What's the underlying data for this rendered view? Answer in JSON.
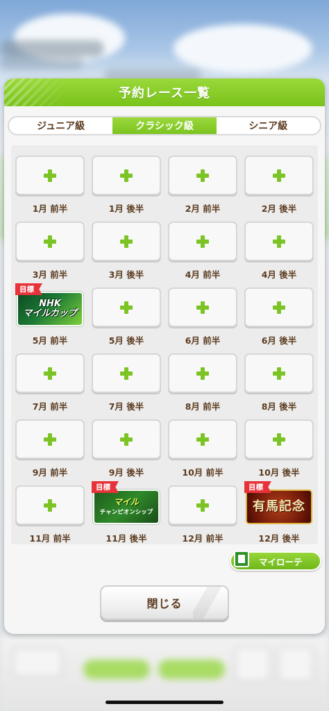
{
  "dialog": {
    "title": "予約レース一覧",
    "tabs": [
      {
        "label": "ジュニア級",
        "active": false
      },
      {
        "label": "クラシック級",
        "active": true
      },
      {
        "label": "シニア級",
        "active": false
      }
    ],
    "slots": [
      {
        "label": "1月 前半"
      },
      {
        "label": "1月 後半"
      },
      {
        "label": "2月 前半"
      },
      {
        "label": "2月 後半"
      },
      {
        "label": "3月 前半"
      },
      {
        "label": "3月 後半"
      },
      {
        "label": "4月 前半"
      },
      {
        "label": "4月 後半"
      },
      {
        "label": "5月 前半",
        "race": {
          "name": "NHKマイルカップ",
          "line1": "NHK",
          "line2": "マイルカップ",
          "tag": "目標"
        }
      },
      {
        "label": "5月 後半"
      },
      {
        "label": "6月 前半"
      },
      {
        "label": "6月 後半"
      },
      {
        "label": "7月 前半"
      },
      {
        "label": "7月 後半"
      },
      {
        "label": "8月 前半"
      },
      {
        "label": "8月 後半"
      },
      {
        "label": "9月 前半"
      },
      {
        "label": "9月 後半"
      },
      {
        "label": "10月 前半"
      },
      {
        "label": "10月 後半"
      },
      {
        "label": "11月 前半"
      },
      {
        "label": "11月 後半",
        "race": {
          "name": "マイルチャンピオンシップ",
          "line1": "マイル",
          "line2": "チャンピオンシップ",
          "tag": "目標"
        }
      },
      {
        "label": "12月 前半"
      },
      {
        "label": "12月 後半",
        "race": {
          "name": "有馬記念",
          "line1": "有馬記念",
          "line2": "",
          "tag": "目標"
        }
      }
    ],
    "my_rotation_label": "マイローテ",
    "close_label": "閉じる"
  },
  "colors": {
    "accent_green": "#7cc425",
    "label_brown": "#5b3b1f",
    "goal_red": "#e8323a"
  },
  "icons": {
    "empty_slot": "plus-icon",
    "my_rotation": "notebook-icon"
  }
}
